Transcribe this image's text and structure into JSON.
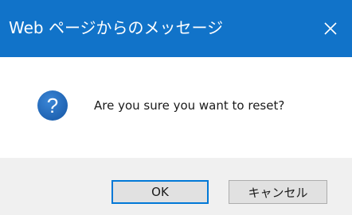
{
  "window": {
    "title": "Web ページからのメッセージ",
    "close_glyph": "✕"
  },
  "dialog": {
    "icon": "question-icon",
    "icon_glyph": "?",
    "message": "Are you sure you want to reset?"
  },
  "buttons": {
    "ok_label": "OK",
    "cancel_label": "キャンセル"
  },
  "colors": {
    "titlebar": "#1173c9",
    "icon_blue": "#1c64b4",
    "footer": "#f0f0f0",
    "default_button_border": "#0078d7"
  }
}
